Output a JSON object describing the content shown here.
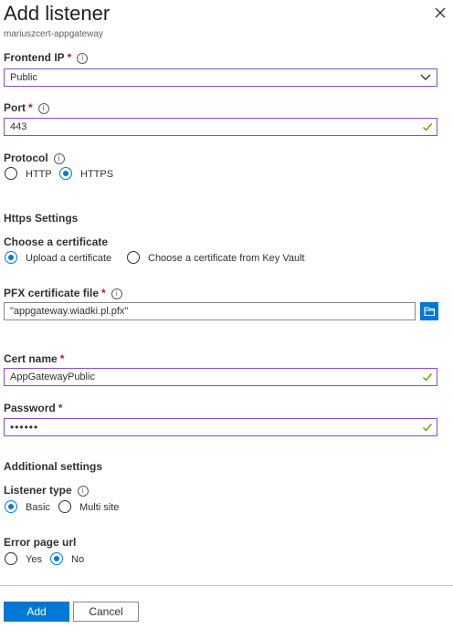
{
  "header": {
    "title": "Add listener",
    "subtitle": "mariuszcert-appgateway"
  },
  "frontend_ip": {
    "label": "Frontend IP",
    "required_mark": "*",
    "value": "Public"
  },
  "port": {
    "label": "Port",
    "required_mark": "*",
    "value": "443"
  },
  "protocol": {
    "label": "Protocol",
    "options": [
      "HTTP",
      "HTTPS"
    ],
    "selected": "HTTPS"
  },
  "https_settings": {
    "heading": "Https Settings",
    "certificate_choice": {
      "label": "Choose a certificate",
      "options": [
        "Upload a certificate",
        "Choose a certificate from Key Vault"
      ],
      "selected": "Upload a certificate"
    },
    "pfx_file": {
      "label": "PFX certificate file",
      "required_mark": "*",
      "value": "\"appgateway.wiadki.pl.pfx\""
    },
    "cert_name": {
      "label": "Cert name",
      "required_mark": "*",
      "value": "AppGatewayPublic"
    },
    "password": {
      "label": "Password",
      "required_mark": "*",
      "value": "••••••"
    }
  },
  "additional": {
    "heading": "Additional settings",
    "listener_type": {
      "label": "Listener type",
      "options": [
        "Basic",
        "Multi site"
      ],
      "selected": "Basic"
    },
    "error_page": {
      "label": "Error page url",
      "options": [
        "Yes",
        "No"
      ],
      "selected": "No"
    }
  },
  "footer": {
    "add_label": "Add",
    "cancel_label": "Cancel"
  },
  "colors": {
    "accent": "#0078d4",
    "focus_border": "#8a4fbf",
    "valid_check": "#57a300",
    "required": "#a4262c"
  },
  "icons": [
    "close-icon",
    "info-icon",
    "chevron-down-icon",
    "checkmark-icon",
    "folder-icon"
  ]
}
